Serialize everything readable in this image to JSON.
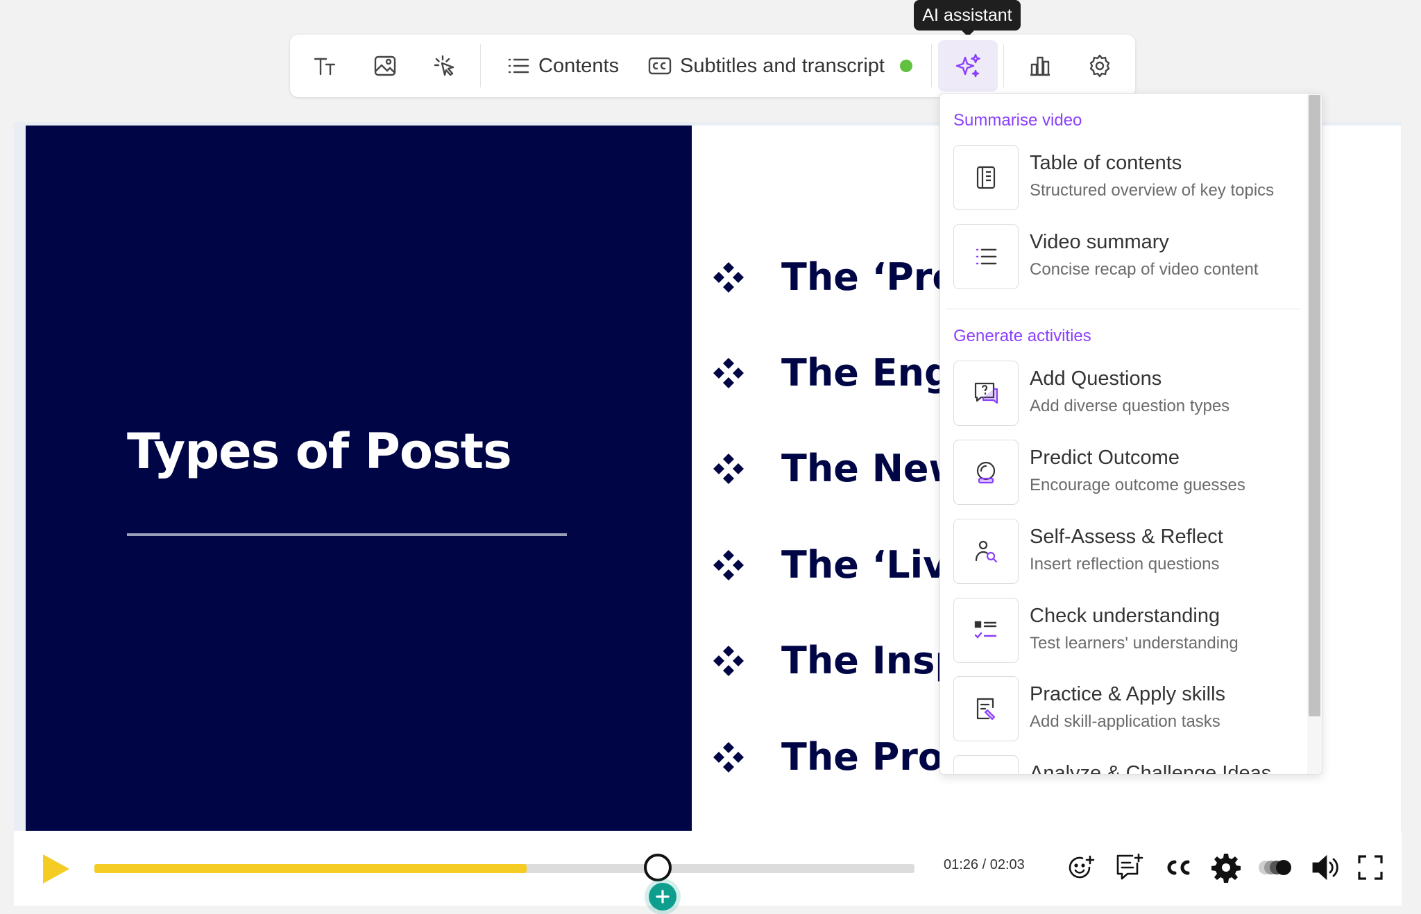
{
  "tooltip": {
    "text": "AI assistant"
  },
  "toolbar": {
    "contents_label": "Contents",
    "subtitles_label": "Subtitles and transcript",
    "subtitles_status_color": "#61c13f",
    "icons": [
      "text-size-icon",
      "image-icon",
      "cursor-click-icon",
      "list-icon",
      "cc-icon",
      "sparkles-icon",
      "bar-chart-icon",
      "gear-icon"
    ]
  },
  "slide": {
    "title": "Types of Posts",
    "bullets": [
      "The ‘Proc",
      "The Enga",
      "The News",
      "The ‘Live",
      "The Inspi",
      "The Prom"
    ],
    "left_bg": "#000645",
    "text_color": "#000645"
  },
  "ai_menu": {
    "summarise_heading": "Summarise video",
    "summarise_items": [
      {
        "label": "Table of contents",
        "desc": "Structured overview of key topics"
      },
      {
        "label": "Video summary",
        "desc": "Concise recap of video content"
      }
    ],
    "activities_heading": "Generate activities",
    "activity_items": [
      {
        "label": "Add Questions",
        "desc": "Add diverse question types"
      },
      {
        "label": "Predict Outcome",
        "desc": "Encourage outcome guesses"
      },
      {
        "label": "Self-Assess & Reflect",
        "desc": "Insert reflection questions"
      },
      {
        "label": "Check understanding",
        "desc": "Test learners' understanding"
      },
      {
        "label": "Practice & Apply skills",
        "desc": "Add skill-application tasks"
      },
      {
        "label": "Analyze & Challenge Ideas",
        "desc": ""
      }
    ],
    "accent_color": "#8a3ffc"
  },
  "player": {
    "time": "01:26 / 02:03",
    "progress": 0.527,
    "accent_color": "#f5cc24"
  }
}
